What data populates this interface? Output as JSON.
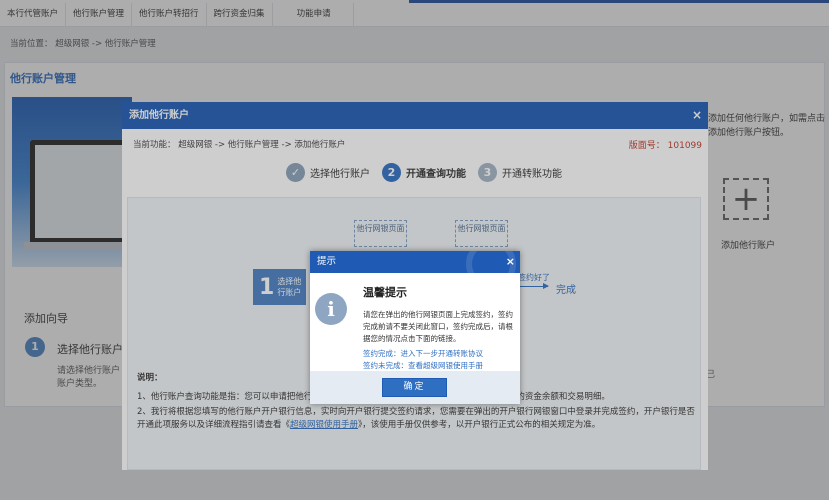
{
  "nav": {
    "tabs": [
      "本行代管账户",
      "他行账户管理",
      "他行账户转招行",
      "跨行资金归集",
      "功能申请"
    ]
  },
  "breadcrumb": "当前位置： 超级网银 -> 他行账户管理",
  "page_title": "他行账户管理",
  "guide": {
    "title": "添加向导",
    "step_number": "1",
    "step_label": "选择他行账户",
    "step_desc": "请选择他行账户账户类型。"
  },
  "right_panel": {
    "desc": "添加任何他行账户，如需点击添加他行账户按钮。",
    "add_icon": "+",
    "add_label": "添加他行账户",
    "mark": "己"
  },
  "modal": {
    "title": "添加他行账户",
    "close": "×",
    "breadcrumb": "当前功能： 超级网银 -> 他行账户管理 -> 添加他行账户",
    "version": "版面号： 101099",
    "steps": [
      {
        "number": "✓",
        "label": "选择他行账户",
        "state": "done"
      },
      {
        "number": "2",
        "label": "开通查询功能",
        "state": "active"
      },
      {
        "number": "3",
        "label": "开通转账功能",
        "state": "todo"
      }
    ],
    "flow": {
      "box_a": "他行网银页面",
      "box_b": "他行网银页面",
      "step1_number": "1",
      "step1_label": "选择他行账户",
      "done_note": "签约好了",
      "done_label": "完成"
    },
    "notes": {
      "heading": "说明：",
      "line1": "1、他行账户查询功能是指：您可以申请把他行账户添加到招行网银，通过招行网银免费查询他行账户的资金余额和交易明细。",
      "line2_a": "2、我行将根据您填写的他行账户开户银行信息，实时向开户银行提交签约请求，您需要在弹出的开户银行网银窗口中登录并完成签约，开户银行是否开通此项服务以及详细流程指引请查看《",
      "line2_link": "超级网银使用手册",
      "line2_b": "》，该使用手册仅供参考，以开户银行正式公布的相关规定为准。"
    }
  },
  "alert": {
    "title": "提示",
    "close": "×",
    "icon": "i",
    "heading": "温馨提示",
    "message": "请您在弹出的他行网银页面上完成签约，签约完成前请不要关闭此窗口，签约完成后，请根据您的情况点击下面的链接。",
    "link_done": "签约完成：进入下一步开通转账协议",
    "link_not_done": "签约未完成：查看超级网银使用手册",
    "ok": "确定"
  }
}
